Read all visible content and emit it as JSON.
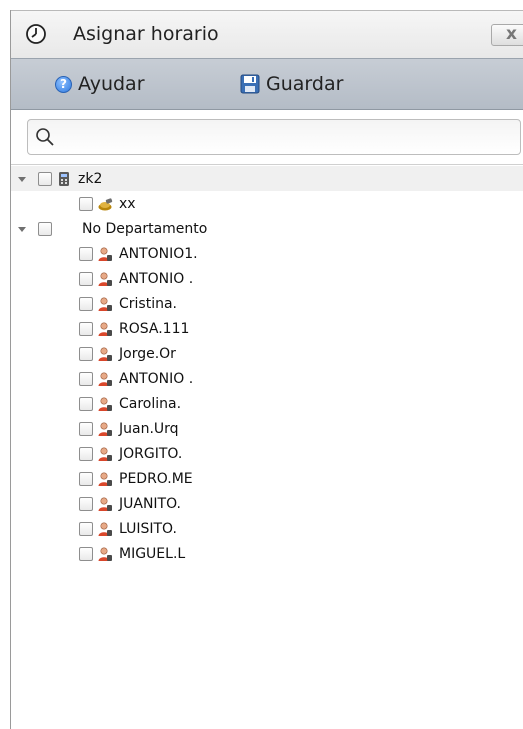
{
  "window": {
    "title": "Asignar horario",
    "close_label": "x",
    "title_icon": "clock-icon"
  },
  "toolbar": {
    "help_label": "Ayudar",
    "help_icon": "help-icon",
    "save_label": "Guardar",
    "save_icon": "floppy-disk-icon"
  },
  "search": {
    "placeholder": "",
    "value": "",
    "icon": "search-icon"
  },
  "tree": {
    "root": {
      "label": "zk2",
      "icon": "device-icon",
      "expanded": true,
      "children": [
        {
          "label": "xx",
          "icon": "folder-icon"
        }
      ]
    },
    "no_dept": {
      "label": "No Departamento",
      "expanded": true,
      "users": [
        {
          "label": "ANTONIO1."
        },
        {
          "label": "ANTONIO ."
        },
        {
          "label": "Cristina."
        },
        {
          "label": "ROSA.111"
        },
        {
          "label": "Jorge.Or"
        },
        {
          "label": "ANTONIO ."
        },
        {
          "label": "Carolina."
        },
        {
          "label": "Juan.Urq"
        },
        {
          "label": "JORGITO."
        },
        {
          "label": "PEDRO.ME"
        },
        {
          "label": "JUANITO."
        },
        {
          "label": "LUISITO."
        },
        {
          "label": "MIGUEL.L"
        }
      ]
    }
  },
  "colors": {
    "toolbar_bg": "#bcc3cc",
    "title_bg": "#f0f0f0",
    "user_icon_accent": "#d9472b"
  }
}
